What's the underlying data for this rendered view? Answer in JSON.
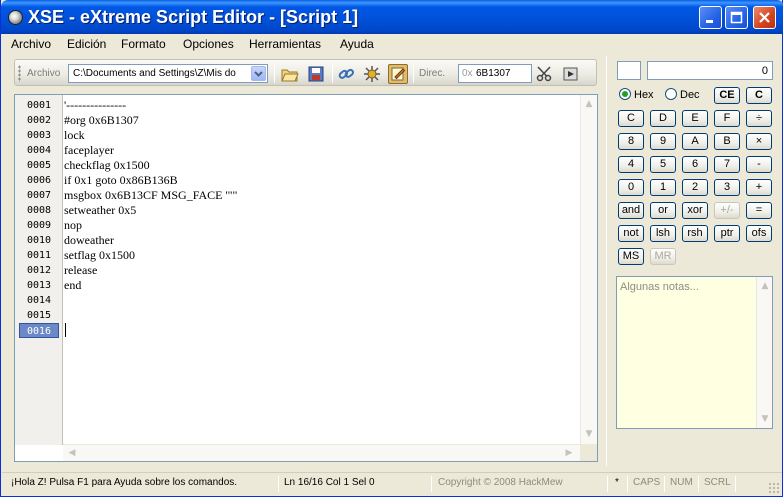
{
  "window": {
    "title": "XSE - eXtreme Script Editor - [Script 1]"
  },
  "menu": [
    "Archivo",
    "Edición",
    "Formato",
    "Opciones",
    "Herramientas",
    "Ayuda"
  ],
  "toolbar": {
    "archivo_label": "Archivo",
    "path": "C:\\Documents and Settings\\Z\\Mis do",
    "direc_label": "Direc.",
    "offset_prefix": "0x",
    "offset_value": "6B1307"
  },
  "editor": {
    "line_numbers": [
      "0001",
      "0002",
      "0003",
      "0004",
      "0005",
      "0006",
      "0007",
      "0008",
      "0009",
      "0010",
      "0011",
      "0012",
      "0013",
      "0014",
      "0015",
      "0016"
    ],
    "current_line": "0016",
    "lines": [
      "'---------------",
      "#org 0x6B1307",
      "lock",
      "faceplayer",
      "checkflag 0x1500",
      "if 0x1 goto 0x86B136B",
      "msgbox 0x6B13CF MSG_FACE '\"\"",
      "setweather 0x5",
      "nop",
      "doweather",
      "setflag 0x1500",
      "release",
      "end",
      "",
      "",
      ""
    ]
  },
  "calculator": {
    "display": "0",
    "radix_hex": "Hex",
    "radix_dec": "Dec",
    "ce": "CE",
    "c": "C",
    "rows": [
      [
        "C",
        "D",
        "E",
        "F",
        "÷"
      ],
      [
        "8",
        "9",
        "A",
        "B",
        "×"
      ],
      [
        "4",
        "5",
        "6",
        "7",
        "-"
      ],
      [
        "0",
        "1",
        "2",
        "3",
        "+"
      ],
      [
        "and",
        "or",
        "xor",
        "+/-",
        "="
      ],
      [
        "not",
        "lsh",
        "rsh",
        "ptr",
        "ofs"
      ]
    ],
    "ms": "MS",
    "mr": "MR",
    "notes_placeholder": "Algunas notas..."
  },
  "status": {
    "help": "¡Hola Z! Pulsa F1 para Ayuda sobre los comandos.",
    "position": "Ln 16/16  Col 1  Sel 0",
    "copyright": "Copyright © 2008 HackMew",
    "modified": "*",
    "caps": "CAPS",
    "num": "NUM",
    "scrl": "SCRL"
  }
}
